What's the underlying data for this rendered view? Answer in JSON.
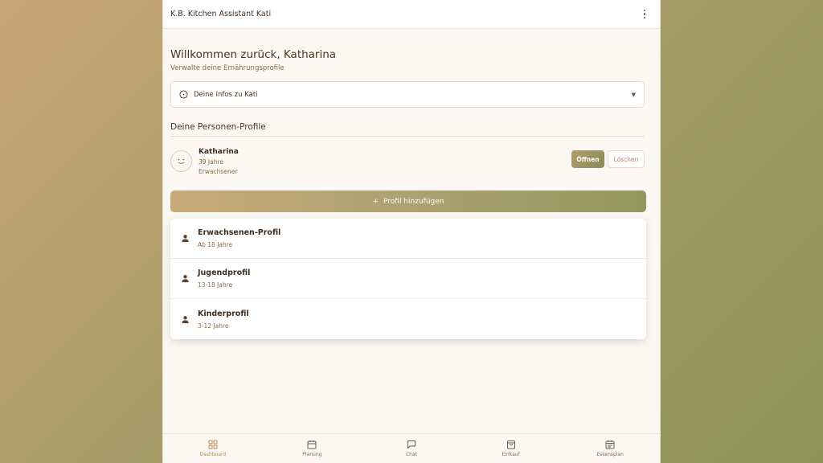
{
  "app": {
    "title": "K.B. Kitchen Assistant Kati"
  },
  "welcome": {
    "title": "Willkommen zurück, Katharina",
    "subtitle": "Verwalte deine Ernährungsprofile"
  },
  "info_section": {
    "label": "Deine Infos zu Kati",
    "icon": "info-circle-icon"
  },
  "profiles_section": {
    "title": "Deine Personen-Profile",
    "profiles": [
      {
        "name": "Katharina",
        "age": "39 Jahre",
        "type": "Erwachsener",
        "open_label": "Öffnen",
        "delete_label": "Löschen"
      }
    ]
  },
  "add_profile": {
    "label": "Profil hinzufügen",
    "options": [
      {
        "title": "Erwachsenen-Profil",
        "subtitle": "Ab 18 Jahre"
      },
      {
        "title": "Jugendprofil",
        "subtitle": "13-18 Jahre"
      },
      {
        "title": "Kinderprofil",
        "subtitle": "3-12 Jahre"
      }
    ]
  },
  "bottom_nav": [
    {
      "label": "Dashboard",
      "icon": "grid-icon",
      "active": true
    },
    {
      "label": "Planung",
      "icon": "calendar-icon"
    },
    {
      "label": "Chat",
      "icon": "chat-icon"
    },
    {
      "label": "Einkauf",
      "icon": "shopping-bag-icon"
    },
    {
      "label": "Essensplan",
      "icon": "meal-plan-icon"
    }
  ],
  "colors": {
    "accent": "#b8894e",
    "text": "#3e2d1e",
    "muted": "#8a6a4a",
    "delete": "#c77a72"
  }
}
